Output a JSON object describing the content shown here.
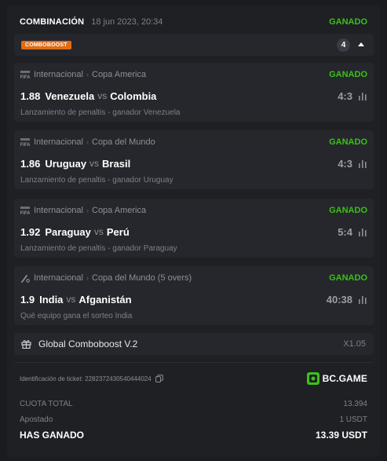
{
  "header": {
    "label": "COMBINACIÓN",
    "date": "18 jun 2023, 20:34",
    "status": "GANADO",
    "status_color": "#3bc117"
  },
  "combo": {
    "badge": "COMBOBOOST",
    "badge_color": "#e06b14",
    "count": "4",
    "toggle_icon": "caret-up-icon"
  },
  "bets": [
    {
      "sport_icon": "fifa-icon",
      "category": "Internacional",
      "separator": "›",
      "league": "Copa America",
      "status": "GANADO",
      "odds": "1.88",
      "home": "Venezuela",
      "vs": "vs",
      "away": "Colombia",
      "score": "4:3",
      "market": "Lanzamiento de penaltis - ganador Venezuela"
    },
    {
      "sport_icon": "fifa-icon",
      "category": "Internacional",
      "separator": "›",
      "league": "Copa del Mundo",
      "status": "GANADO",
      "odds": "1.86",
      "home": "Uruguay",
      "vs": "vs",
      "away": "Brasil",
      "score": "4:3",
      "market": "Lanzamiento de penaltis - ganador Uruguay"
    },
    {
      "sport_icon": "fifa-icon",
      "category": "Internacional",
      "separator": "›",
      "league": "Copa America",
      "status": "GANADO",
      "odds": "1.92",
      "home": "Paraguay",
      "vs": "vs",
      "away": "Perú",
      "score": "5:4",
      "market": "Lanzamiento de penaltis - ganador Paraguay"
    },
    {
      "sport_icon": "cricket-icon",
      "category": "Internacional",
      "separator": "›",
      "league": "Copa del Mundo (5 overs)",
      "status": "GANADO",
      "odds": "1.9",
      "home": "India",
      "vs": "vs",
      "away": "Afganistán",
      "score": "40:38",
      "market": "Qué equipo gana el sorteo India"
    }
  ],
  "boost": {
    "icon": "gift-icon",
    "name": "Global Comboboost V.2",
    "multiplier": "X1.05"
  },
  "ticket": {
    "id_label": "Identificación de ticket: 2282372430540444024",
    "copy_icon": "copy-icon",
    "brand": "BC.GAME",
    "brand_color": "#3bc117"
  },
  "summary": {
    "odds_label": "CUOTA TOTAL",
    "odds_value": "13.394",
    "stake_label": "Apostado",
    "stake_value": "1 USDT",
    "won_label": "HAS GANADO",
    "won_value": "13.39 USDT"
  }
}
